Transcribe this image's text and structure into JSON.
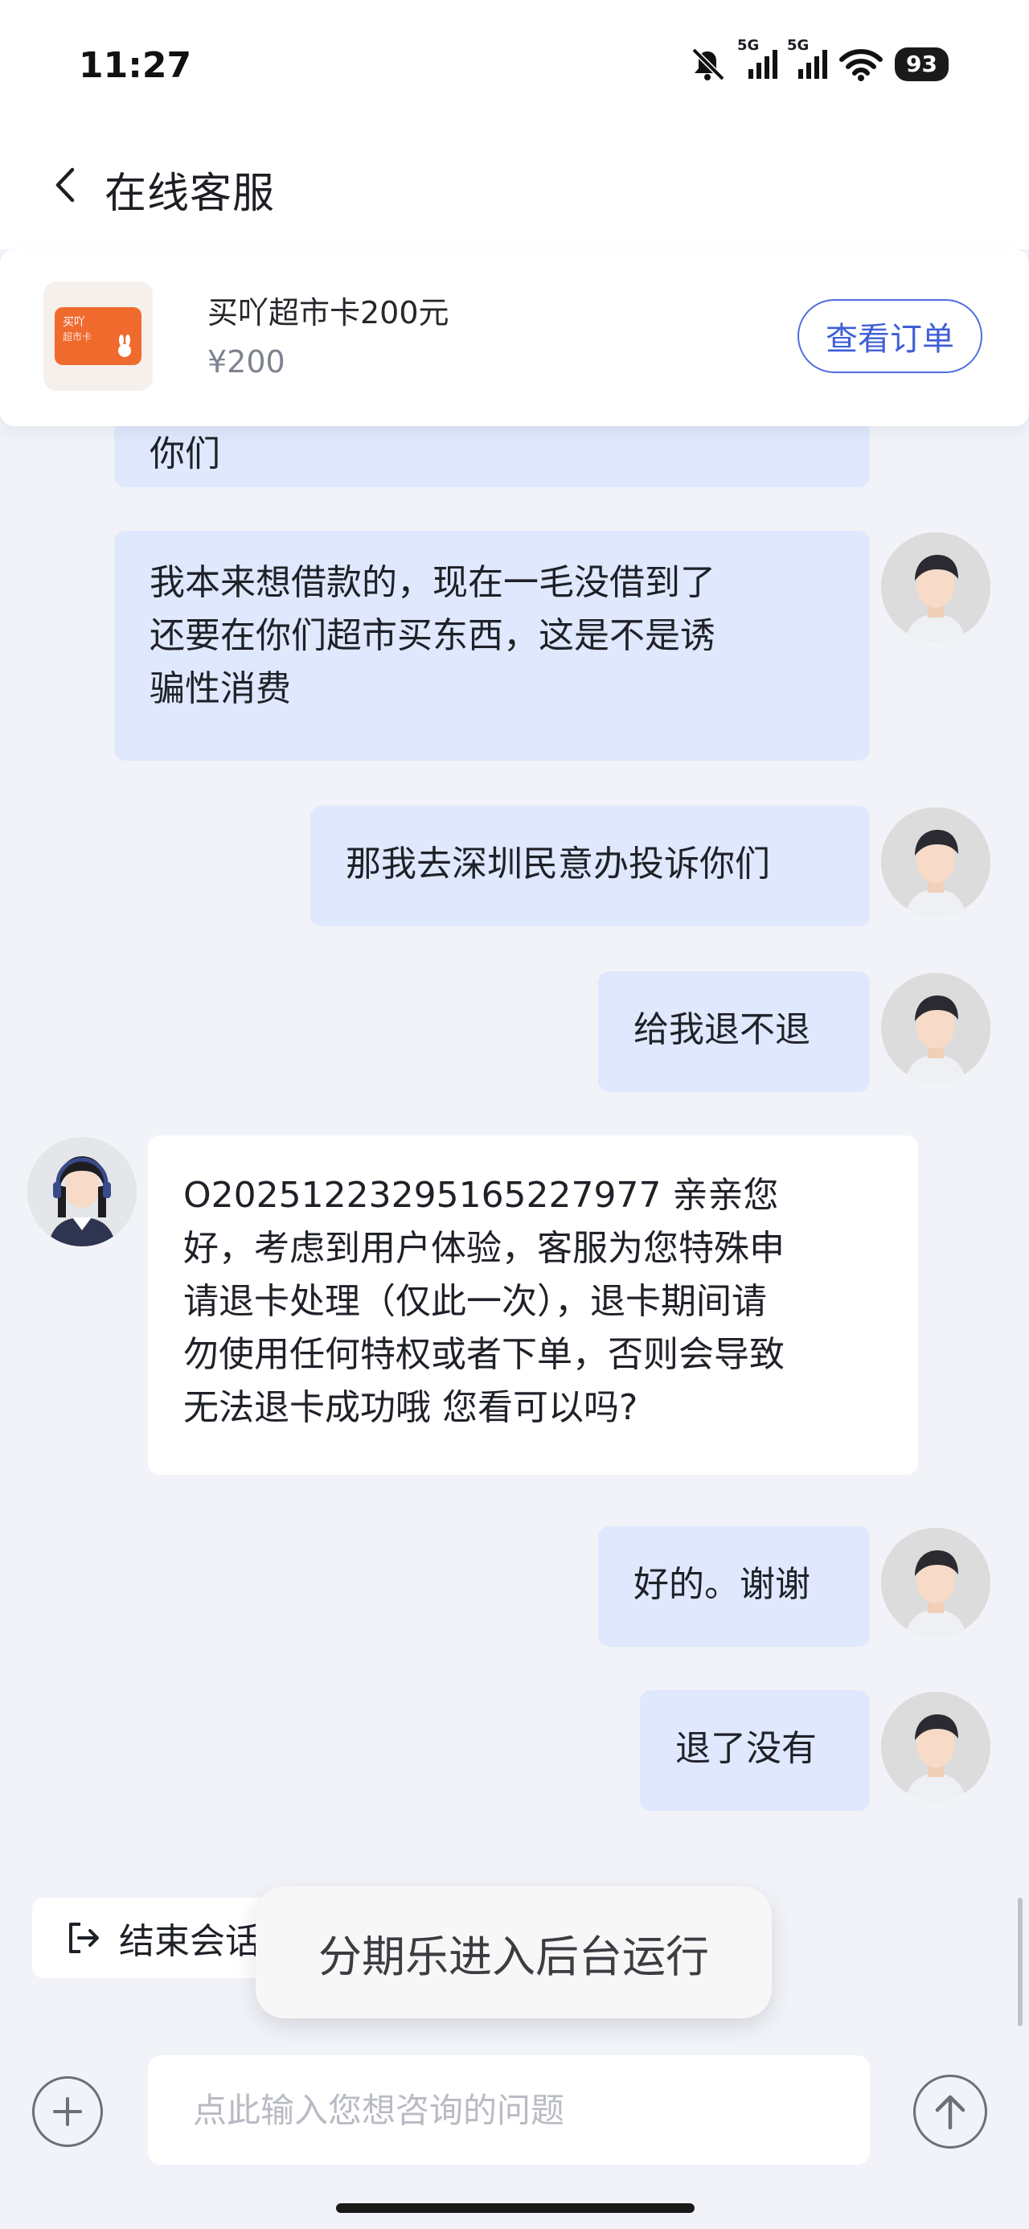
{
  "status_bar": {
    "time": "11:27",
    "network_1": "5G",
    "network_2": "5G",
    "battery": "93"
  },
  "header": {
    "title": "在线客服"
  },
  "product": {
    "name": "买吖超市卡200元",
    "price": "¥200",
    "view_order_label": "查看订单",
    "thumb_brand": "买吖",
    "thumb_text": "超市卡"
  },
  "messages": [
    {
      "from": "user",
      "text": "你们"
    },
    {
      "from": "user",
      "lines": [
        "我本来想借款的，现在一毛没借到了",
        "还要在你们超市买东西，这是不是诱",
        "骗性消费"
      ]
    },
    {
      "from": "user",
      "text": "那我去深圳民意办投诉你们"
    },
    {
      "from": "user",
      "text": "给我退不退"
    },
    {
      "from": "agent",
      "lines": [
        "O20251223295165227977  亲亲您",
        "好，考虑到用户体验，客服为您特殊申",
        "请退卡处理（仅此一次），退卡期间请",
        "勿使用任何特权或者下单，否则会导致",
        "无法退卡成功哦  您看可以吗?"
      ]
    },
    {
      "from": "user",
      "text": "好的。谢谢"
    },
    {
      "from": "user",
      "text": "退了没有"
    }
  ],
  "end_session": {
    "label": "结束会话"
  },
  "toast": {
    "text": "分期乐进入后台运行"
  },
  "input": {
    "placeholder": "点此输入您想咨询的问题"
  },
  "colors": {
    "user_bubble": "#dfe8fc",
    "agent_bubble": "#ffffff",
    "accent": "#3f5fd6",
    "thumb_card": "#f06a2e"
  }
}
